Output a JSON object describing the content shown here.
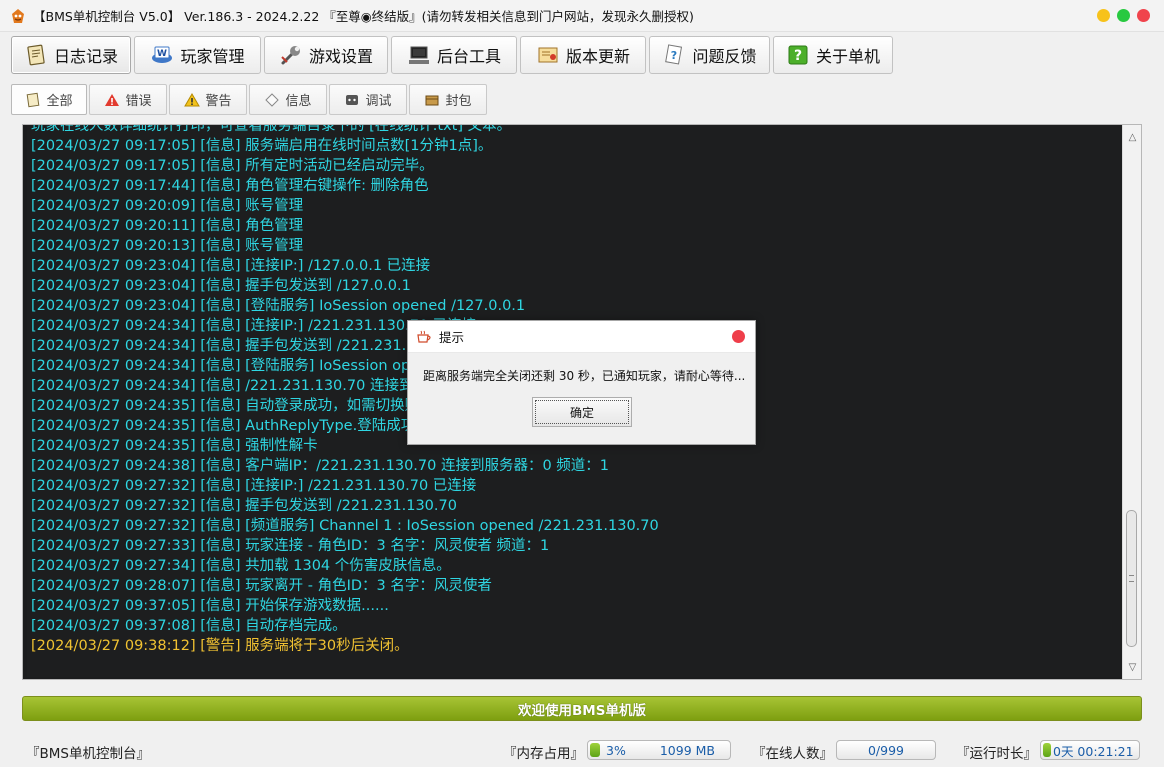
{
  "window": {
    "title": "【BMS单机控制台 V5.0】 Ver.186.3 - 2024.2.22 『至尊◉终结版』(请勿转发相关信息到门户网站，发现永久删授权)"
  },
  "main_tabs": [
    {
      "label": "日志记录",
      "icon": "notebook-icon",
      "active": true
    },
    {
      "label": "玩家管理",
      "icon": "word-w-icon",
      "active": false
    },
    {
      "label": "游戏设置",
      "icon": "wrench-icon",
      "active": false
    },
    {
      "label": "后台工具",
      "icon": "computer-icon",
      "active": false
    },
    {
      "label": "版本更新",
      "icon": "certificate-icon",
      "active": false
    },
    {
      "label": "问题反馈",
      "icon": "question-card-icon",
      "active": false
    },
    {
      "label": "关于单机",
      "icon": "help-icon",
      "active": false
    }
  ],
  "sub_tabs": [
    {
      "label": "全部",
      "icon": "page-icon",
      "active": true
    },
    {
      "label": "错误",
      "icon": "error-icon",
      "active": false
    },
    {
      "label": "警告",
      "icon": "warning-icon",
      "active": false
    },
    {
      "label": "信息",
      "icon": "info-icon",
      "active": false
    },
    {
      "label": "调试",
      "icon": "debug-icon",
      "active": false
    },
    {
      "label": "封包",
      "icon": "packet-icon",
      "active": false
    }
  ],
  "log_lines": [
    {
      "text": "玩家在线人数详细统计打印，可查看服务端目录下的 [在线统计.txt] 文本。",
      "level": "info"
    },
    {
      "text": "[2024/03/27 09:17:05] [信息] 服务端启用在线时间点数[1分钟1点]。",
      "level": "info"
    },
    {
      "text": "[2024/03/27 09:17:05] [信息] 所有定时活动已经启动完毕。",
      "level": "info"
    },
    {
      "text": "[2024/03/27 09:17:44] [信息] 角色管理右键操作: 删除角色",
      "level": "info"
    },
    {
      "text": "[2024/03/27 09:20:09] [信息] 账号管理",
      "level": "info"
    },
    {
      "text": "[2024/03/27 09:20:11] [信息] 角色管理",
      "level": "info"
    },
    {
      "text": "[2024/03/27 09:20:13] [信息] 账号管理",
      "level": "info"
    },
    {
      "text": "[2024/03/27 09:23:04] [信息] [连接IP:] /127.0.0.1 已连接",
      "level": "info"
    },
    {
      "text": "[2024/03/27 09:23:04] [信息] 握手包发送到 /127.0.0.1",
      "level": "info"
    },
    {
      "text": "[2024/03/27 09:23:04] [信息] [登陆服务] IoSession opened /127.0.0.1",
      "level": "info"
    },
    {
      "text": "[2024/03/27 09:24:34] [信息] [连接IP:] /221.231.130.70 已连接",
      "level": "info"
    },
    {
      "text": "[2024/03/27 09:24:34] [信息] 握手包发送到 /221.231.130.70",
      "level": "info"
    },
    {
      "text": "[2024/03/27 09:24:34] [信息] [登陆服务] IoSession opened /221.231.130.70",
      "level": "info"
    },
    {
      "text": "[2024/03/27 09:24:34] [信息] /221.231.130.70 连接到服务器",
      "level": "info"
    },
    {
      "text": "[2024/03/27 09:24:35] [信息] 自动登录成功，如需切换账号",
      "level": "info"
    },
    {
      "text": "[2024/03/27 09:24:35] [信息] AuthReplyType.登陆成功",
      "level": "info"
    },
    {
      "text": "[2024/03/27 09:24:35] [信息] 强制性解卡",
      "level": "info"
    },
    {
      "text": "[2024/03/27 09:24:38] [信息] 客户端IP：/221.231.130.70 连接到服务器：0 频道：1",
      "level": "info"
    },
    {
      "text": "[2024/03/27 09:27:32] [信息] [连接IP:] /221.231.130.70 已连接",
      "level": "info"
    },
    {
      "text": "[2024/03/27 09:27:32] [信息] 握手包发送到 /221.231.130.70",
      "level": "info"
    },
    {
      "text": "[2024/03/27 09:27:32] [信息] [频道服务] Channel 1 : IoSession opened /221.231.130.70",
      "level": "info"
    },
    {
      "text": "[2024/03/27 09:27:33] [信息] 玩家连接 - 角色ID：3 名字：风灵使者 频道：1",
      "level": "info"
    },
    {
      "text": "[2024/03/27 09:27:34] [信息] 共加载 1304 个伤害皮肤信息。",
      "level": "info"
    },
    {
      "text": "[2024/03/27 09:28:07] [信息] 玩家离开 - 角色ID：3 名字：风灵使者",
      "level": "info"
    },
    {
      "text": "[2024/03/27 09:37:05] [信息] 开始保存游戏数据......",
      "level": "info"
    },
    {
      "text": "[2024/03/27 09:37:08] [信息] 自动存档完成。",
      "level": "info"
    },
    {
      "text": "[2024/03/27 09:38:12] [警告] 服务端将于30秒后关闭。",
      "level": "warn"
    }
  ],
  "welcome": {
    "text": "欢迎使用BMS单机版"
  },
  "status": {
    "app_label": "『BMS单机控制台』",
    "memory_label": "『内存占用』",
    "memory_percent": "3%",
    "memory_percent_value": 3,
    "memory_size": "1099 MB",
    "online_label": "『在线人数』",
    "online_value": "0/999",
    "runtime_label": "『运行时长』",
    "runtime_value": "0天 00:21:21"
  },
  "dialog": {
    "title": "提示",
    "message": "距离服务端完全关闭还剩 30 秒，已通知玩家，请耐心等待...",
    "ok_label": "确定"
  },
  "colors": {
    "log_info": "#2fd6e2",
    "log_warn": "#f1c232",
    "welcome_bar": "#8fb022",
    "log_background": "#1d1e1f"
  }
}
